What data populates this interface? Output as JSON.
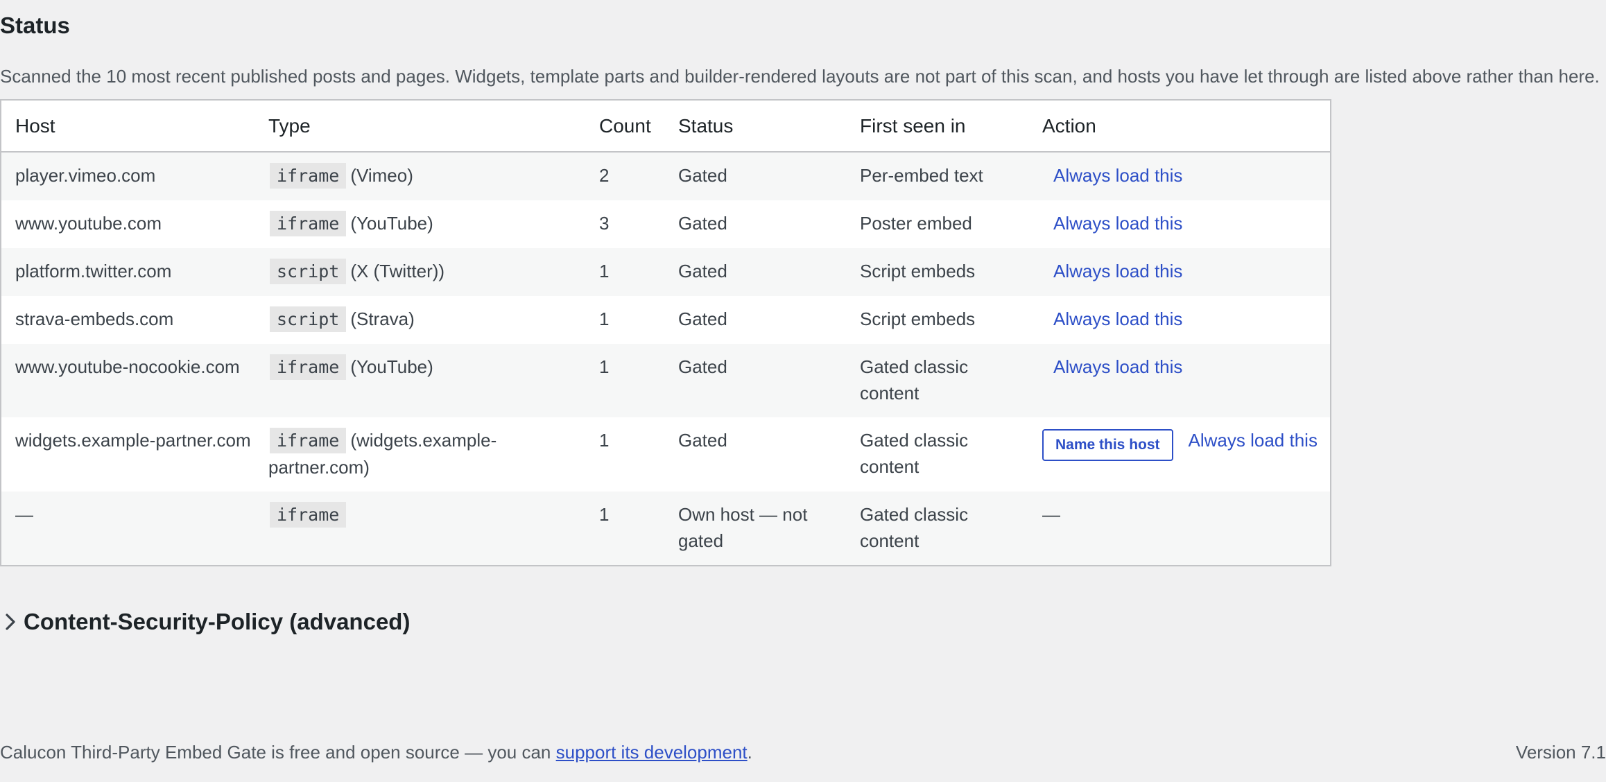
{
  "section": {
    "heading": "Status",
    "intro": "Scanned the 10 most recent published posts and pages. Widgets, template parts and builder-rendered layouts are not part of this scan, and hosts you have let through are listed above rather than here."
  },
  "table": {
    "headers": [
      "Host",
      "Type",
      "Count",
      "Status",
      "First seen in",
      "Action"
    ],
    "rows": [
      {
        "host": "player.vimeo.com",
        "type_code": "iframe",
        "type_label": "(Vimeo)",
        "count": "2",
        "status": "Gated",
        "first_seen": "Per-embed text",
        "name_button": "",
        "action_link": "Always load this",
        "action_text": ""
      },
      {
        "host": "www.youtube.com",
        "type_code": "iframe",
        "type_label": "(YouTube)",
        "count": "3",
        "status": "Gated",
        "first_seen": "Poster embed",
        "name_button": "",
        "action_link": "Always load this",
        "action_text": ""
      },
      {
        "host": "platform.twitter.com",
        "type_code": "script",
        "type_label": "(X (Twitter))",
        "count": "1",
        "status": "Gated",
        "first_seen": "Script embeds",
        "name_button": "",
        "action_link": "Always load this",
        "action_text": ""
      },
      {
        "host": "strava-embeds.com",
        "type_code": "script",
        "type_label": "(Strava)",
        "count": "1",
        "status": "Gated",
        "first_seen": "Script embeds",
        "name_button": "",
        "action_link": "Always load this",
        "action_text": ""
      },
      {
        "host": "www.youtube-nocookie.com",
        "type_code": "iframe",
        "type_label": "(YouTube)",
        "count": "1",
        "status": "Gated",
        "first_seen": "Gated classic content",
        "name_button": "",
        "action_link": "Always load this",
        "action_text": ""
      },
      {
        "host": "widgets.example-partner.com",
        "type_code": "iframe",
        "type_label": "(widgets.example-partner.com)",
        "count": "1",
        "status": "Gated",
        "first_seen": "Gated classic content",
        "name_button": "Name this host",
        "action_link": "Always load this",
        "action_text": ""
      },
      {
        "host": "—",
        "type_code": "iframe",
        "type_label": "",
        "count": "1",
        "status": "Own host — not gated",
        "first_seen": "Gated classic content",
        "name_button": "",
        "action_link": "",
        "action_text": "—"
      }
    ]
  },
  "csp_section": {
    "title": "Content-Security-Policy (advanced)",
    "icon": "chevron-right-icon"
  },
  "footer": {
    "text_before": "Calucon Third-Party Embed Gate is free and open source — you can ",
    "link": "support its development",
    "text_after": ".",
    "version": "Version 7.1"
  }
}
